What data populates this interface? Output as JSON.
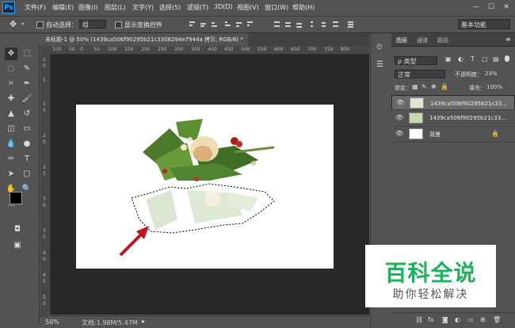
{
  "app": {
    "logo_text": "Ps"
  },
  "menu": [
    "文件(F)",
    "编辑(E)",
    "图像(I)",
    "图层(L)",
    "文字(Y)",
    "选择(S)",
    "滤镜(T)",
    "3D(D)",
    "视图(V)",
    "窗口(W)",
    "帮助(H)"
  ],
  "window_buttons": [
    "—",
    "☐",
    "✕"
  ],
  "options_bar": {
    "auto_select_label": "自动选择：",
    "auto_select_value": "组",
    "show_transform_label": "显示变换控件",
    "workspace": "基本功能"
  },
  "document": {
    "tab_title": "未标题-1 @ 50% (1439ca506f90295b21c3308294e7944a 拷贝, RGB/8) *",
    "close": "×"
  },
  "ruler": {
    "top_ticks": [
      "100",
      "50",
      "0",
      "50",
      "100",
      "150",
      "200",
      "250",
      "300",
      "350",
      "400",
      "450",
      "500",
      "550",
      "600",
      "650",
      "700",
      "750",
      "800"
    ],
    "left_ticks": [
      "1",
      "0",
      "5",
      "1",
      "5",
      "2",
      "0",
      "2",
      "5",
      "3",
      "0",
      "3",
      "5",
      "4",
      "0",
      "4",
      "5",
      "5",
      "0"
    ]
  },
  "status": {
    "zoom": "50%",
    "doc_size": "文档:1.98M/5.47M"
  },
  "panels": {
    "tabs": [
      "图层",
      "通道",
      "路径"
    ],
    "filter_kind": "ρ 类型",
    "blend_mode": "正常",
    "opacity_label": "不透明度：",
    "opacity_value": "23%",
    "lock_label": "锁定：",
    "fill_label": "填充：",
    "fill_value": "100%",
    "layers": [
      {
        "name": "1439ca506f90295b21c33...",
        "selected": true
      },
      {
        "name": "1439ca506f90295b21c33...",
        "selected": false
      },
      {
        "name": "背景",
        "selected": false,
        "locked": true
      }
    ],
    "footer_icons": [
      "link-icon",
      "fx-icon",
      "mask-icon",
      "adjustment-icon",
      "folder-icon",
      "new-layer-icon",
      "trash-icon"
    ]
  },
  "watermark": {
    "title": "百科全说",
    "subtitle": "助你轻松解决"
  },
  "colors": {
    "accent": "#31a8ff",
    "watermark_green": "#19b35a",
    "arrow_red": "#c0151f"
  }
}
